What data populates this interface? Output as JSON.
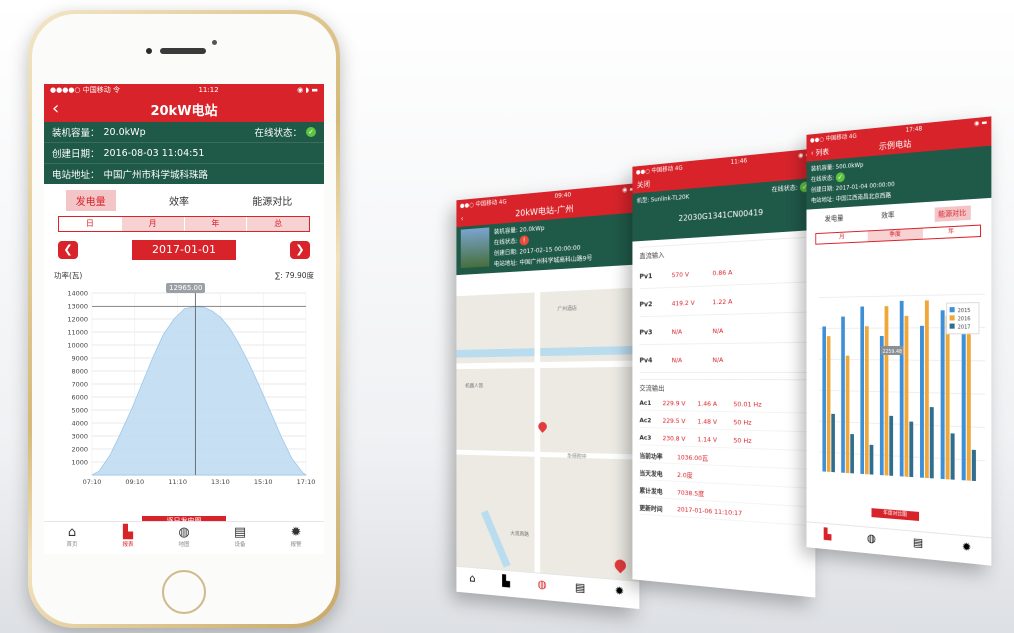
{
  "main": {
    "status": {
      "carrier": "●●●●○ 中国移动 令",
      "time": "11:12",
      "right": "◉ ◗ ▬"
    },
    "nav": {
      "back": "‹",
      "title": "20kW电站"
    },
    "info": {
      "capacity_label": "装机容量：",
      "capacity": "20.0kWp",
      "online_label": "在线状态：",
      "created_label": "创建日期：",
      "created": "2016-08-03 11:04:51",
      "address_label": "电站地址：",
      "address": "中国广州市科学城科珠路"
    },
    "tabs": [
      "发电量",
      "效率",
      "能源对比"
    ],
    "segments": [
      "日",
      "月",
      "年",
      "总"
    ],
    "date": "2017-01-01",
    "prev": "❮",
    "next": "❯",
    "chart_label_left": "功率(瓦)",
    "chart_label_right": "∑: 79.90度",
    "tooltip": "12965.00",
    "redbar": "逐日发电图",
    "bottom": [
      {
        "icon": "home-icon",
        "glyph": "⌂",
        "label": "首页"
      },
      {
        "icon": "chart-icon",
        "glyph": "▙",
        "label": "报表"
      },
      {
        "icon": "globe-icon",
        "glyph": "◍",
        "label": "地图"
      },
      {
        "icon": "device-icon",
        "glyph": "▤",
        "label": "设备"
      },
      {
        "icon": "bulb-icon",
        "glyph": "✹",
        "label": "报警"
      }
    ],
    "colors": {
      "brand_red": "#d8232a",
      "info_green": "#1f5948",
      "area_fill": "#bcd9f1"
    }
  },
  "mini1": {
    "status": {
      "carrier": "●●○ 中国移动 4G",
      "time": "09:40",
      "right": "◉ ▬"
    },
    "nav": {
      "back": "‹",
      "title": "20kW电站-广州"
    },
    "info": [
      "装机容量: 20.0kWp",
      "在线状态:",
      "创建日期: 2017-02-15 00:00:00",
      "电站地址: 中国广州科学城高科山路9号"
    ],
    "map_labels": [
      "广州酒店",
      "华师附中",
      "机器人馆",
      "大观南路"
    ]
  },
  "mini2": {
    "status": {
      "carrier": "●●○ 中国移动 4G",
      "time": "11:46",
      "right": "◉ ▬"
    },
    "nav": {
      "back": "关闭",
      "title": ""
    },
    "model_label": "机型: Sunlink-TL20K",
    "online_label": "在线状态:",
    "serial": "22030G1341CN00419",
    "dc_title": "直流输入",
    "pv": [
      {
        "name": "Pv1",
        "v": "570 V",
        "a": "0.86 A"
      },
      {
        "name": "Pv2",
        "v": "419.2 V",
        "a": "1.22 A"
      },
      {
        "name": "Pv3",
        "v": "N/A",
        "a": "N/A"
      },
      {
        "name": "Pv4",
        "v": "N/A",
        "a": "N/A"
      }
    ],
    "ac_title": "交流输出",
    "ac": [
      {
        "name": "Ac1",
        "v": "229.9 V",
        "a": "1.46 A",
        "hz": "50.01 Hz"
      },
      {
        "name": "Ac2",
        "v": "229.5 V",
        "a": "1.48 V",
        "hz": "50 Hz"
      },
      {
        "name": "Ac3",
        "v": "230.8 V",
        "a": "1.14 V",
        "hz": "50 Hz"
      }
    ],
    "kv": [
      {
        "k": "当前功率",
        "v": "1036.00瓦"
      },
      {
        "k": "当天发电",
        "v": "2.0度"
      },
      {
        "k": "累计发电",
        "v": "7038.5度"
      },
      {
        "k": "更新时间",
        "v": "2017-01-06 11:10:17"
      }
    ]
  },
  "mini3": {
    "status": {
      "carrier": "●●○ 中国移动 4G",
      "time": "17:48",
      "right": "◉ ▬"
    },
    "nav": {
      "back": "‹ 列表",
      "title": "示例电站"
    },
    "info": [
      "装机容量: 500.0kWp",
      "在线状态:",
      "创建日期: 2017-01-04 00:00:00",
      "电站地址: 中国江西南昌北京西路"
    ],
    "tabs": [
      "发电量",
      "效率",
      "能源对比"
    ],
    "segments": [
      "月",
      "季度",
      "年"
    ],
    "tooltip": "2259.48",
    "legend": [
      "2015",
      "2016",
      "2017"
    ],
    "red_label": "年度对比图"
  },
  "chart_data": {
    "type": "area",
    "xlabel": "",
    "ylabel": "功率(瓦)",
    "x_ticks": [
      "07:10",
      "09:10",
      "11:10",
      "13:10",
      "15:10",
      "17:10"
    ],
    "ylim": [
      0,
      14000
    ],
    "y_ticks": [
      1000,
      2000,
      3000,
      4000,
      5000,
      6000,
      7000,
      8000,
      9000,
      10000,
      11000,
      12000,
      13000,
      14000
    ],
    "x_hours": [
      7.17,
      7.5,
      8.0,
      8.5,
      9.0,
      9.5,
      10.0,
      10.5,
      11.0,
      11.5,
      12.0,
      12.4,
      12.8,
      13.2,
      13.6,
      14.0,
      14.5,
      15.0,
      15.5,
      16.0,
      16.5,
      17.0,
      17.17
    ],
    "values": [
      0,
      300,
      1500,
      3200,
      5000,
      7000,
      9000,
      10800,
      12000,
      12800,
      12965,
      12900,
      12600,
      12100,
      11300,
      10200,
      8600,
      6800,
      4900,
      3000,
      1300,
      200,
      0
    ],
    "highlight": {
      "x": "12:00",
      "y": 12965.0
    },
    "grid": true
  }
}
